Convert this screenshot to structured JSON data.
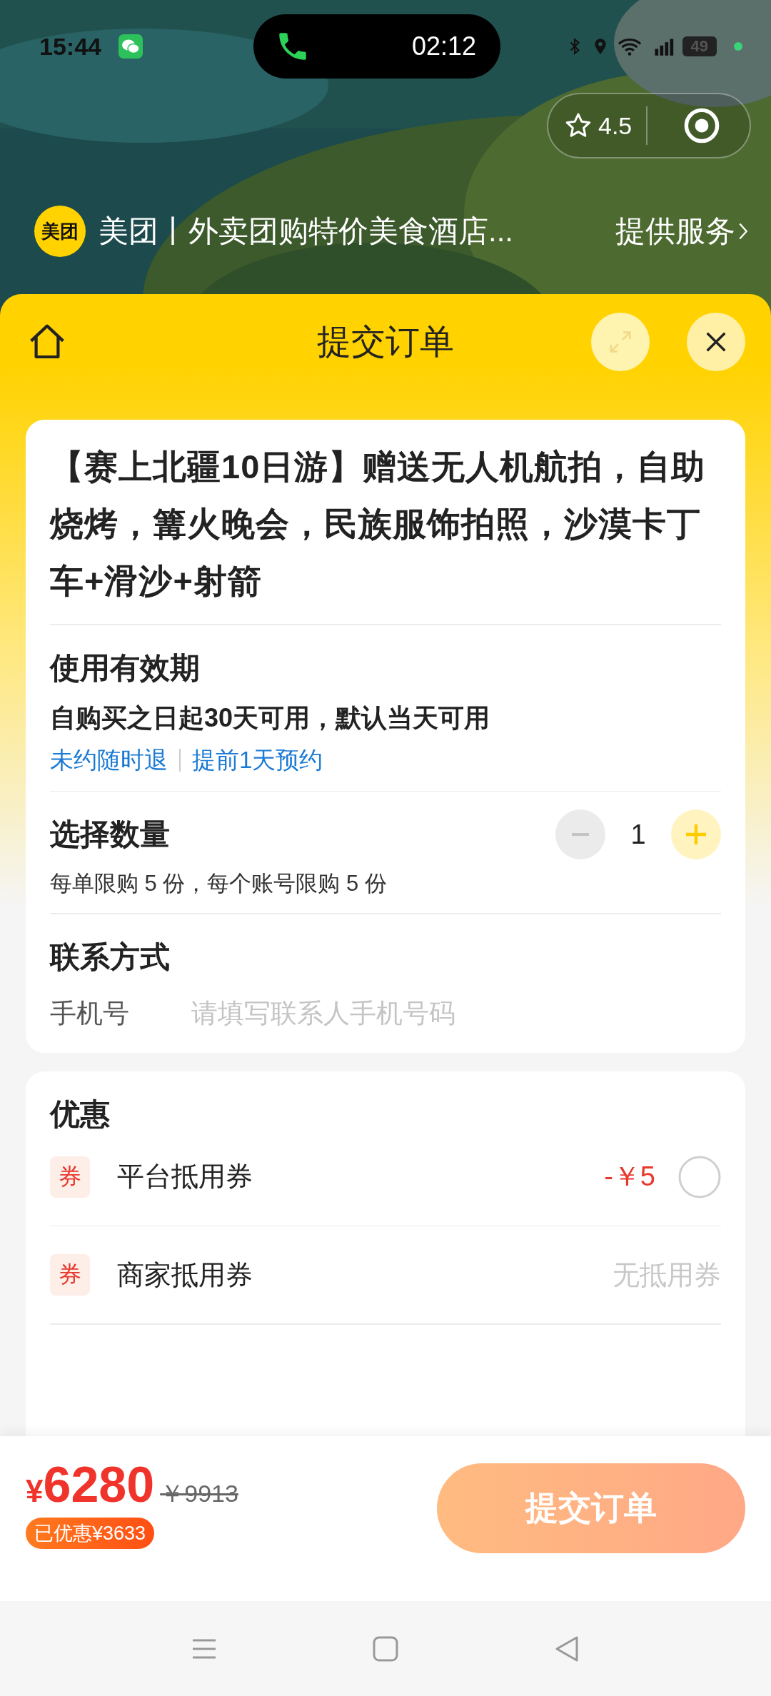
{
  "status_bar": {
    "time": "15:44",
    "call_timer": "02:12",
    "battery": "49"
  },
  "capsule": {
    "rating": "4.5"
  },
  "mini_program": {
    "logo": "美团",
    "name": "美团丨外卖团购特价美食酒店...",
    "service_link": "提供服务"
  },
  "sheet": {
    "title": "提交订单"
  },
  "product": {
    "title": "【赛上北疆10日游】赠送无人机航拍，自助烧烤，篝火晚会，民族服饰拍照，沙漠卡丁车+滑沙+射箭"
  },
  "validity": {
    "heading": "使用有效期",
    "text": "自购买之日起30天可用，默认当天可用",
    "tags": [
      "未约随时退",
      "提前1天预约"
    ]
  },
  "quantity": {
    "heading": "选择数量",
    "value": "1",
    "limit_note": "每单限购 5 份，每个账号限购 5 份"
  },
  "contact": {
    "heading": "联系方式",
    "label": "手机号",
    "placeholder": "请填写联系人手机号码"
  },
  "discounts": {
    "heading": "优惠",
    "items": [
      {
        "badge": "券",
        "name": "平台抵用券",
        "kind": "selectable",
        "value": "-￥5",
        "selected": false
      },
      {
        "badge": "券",
        "name": "商家抵用券",
        "kind": "unavailable",
        "value": "无抵用券"
      }
    ]
  },
  "footer": {
    "currency": "¥",
    "price": "6280",
    "original_price": "￥9913",
    "saved_badge": "已优惠¥3633",
    "submit_button": "提交订单"
  }
}
